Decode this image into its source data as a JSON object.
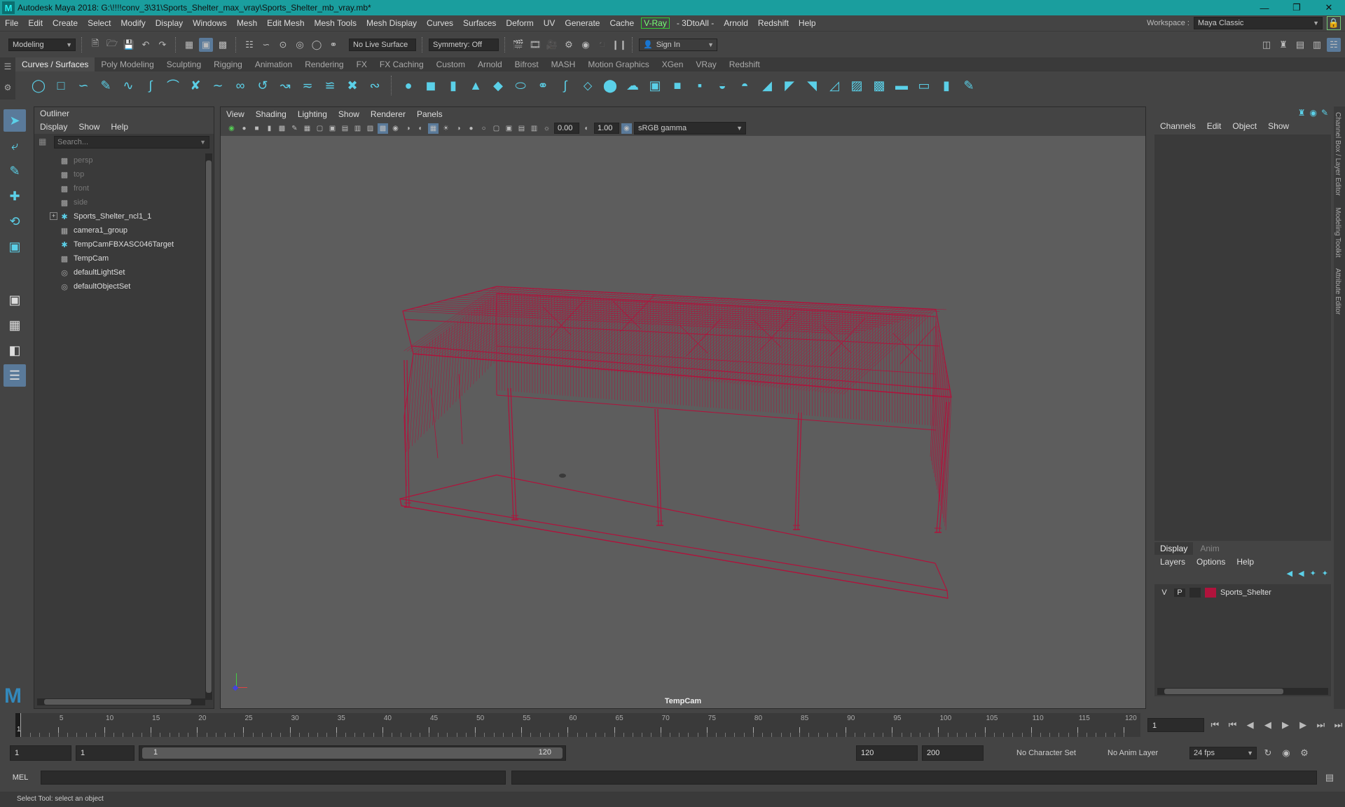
{
  "title": "Autodesk Maya 2018: G:\\!!!!conv_3\\31\\Sports_Shelter_max_vray\\Sports_Shelter_mb_vray.mb*",
  "menu": [
    "File",
    "Edit",
    "Create",
    "Select",
    "Modify",
    "Display",
    "Windows",
    "Mesh",
    "Edit Mesh",
    "Mesh Tools",
    "Mesh Display",
    "Curves",
    "Surfaces",
    "Deform",
    "UV",
    "Generate",
    "Cache",
    "V-Ray",
    "- 3DtoAll -",
    "Arnold",
    "Redshift",
    "Help"
  ],
  "workspace": {
    "label": "Workspace :",
    "value": "Maya Classic"
  },
  "status": {
    "mode": "Modeling",
    "live_surface": "No Live Surface",
    "symmetry": "Symmetry: Off",
    "sign_in": "Sign In"
  },
  "shelf_tabs": [
    "Curves / Surfaces",
    "Poly Modeling",
    "Sculpting",
    "Rigging",
    "Animation",
    "Rendering",
    "FX",
    "FX Caching",
    "Custom",
    "Arnold",
    "Bifrost",
    "MASH",
    "Motion Graphics",
    "XGen",
    "VRay",
    "Redshift"
  ],
  "outliner": {
    "title": "Outliner",
    "menu": [
      "Display",
      "Show",
      "Help"
    ],
    "search_placeholder": "Search...",
    "items": [
      {
        "label": "persp",
        "icon": "camera-icon",
        "dim": true
      },
      {
        "label": "top",
        "icon": "camera-icon",
        "dim": true
      },
      {
        "label": "front",
        "icon": "camera-icon",
        "dim": true
      },
      {
        "label": "side",
        "icon": "camera-icon",
        "dim": true
      },
      {
        "label": "Sports_Shelter_ncl1_1",
        "icon": "transform-icon",
        "dim": false,
        "expand": "+"
      },
      {
        "label": "camera1_group",
        "icon": "group-icon",
        "dim": false
      },
      {
        "label": "TempCamFBXASC046Target",
        "icon": "transform-icon",
        "dim": false
      },
      {
        "label": "TempCam",
        "icon": "camera-icon",
        "dim": false
      },
      {
        "label": "defaultLightSet",
        "icon": "set-icon",
        "dim": false
      },
      {
        "label": "defaultObjectSet",
        "icon": "set-icon",
        "dim": false
      }
    ]
  },
  "viewport": {
    "menu": [
      "View",
      "Shading",
      "Lighting",
      "Show",
      "Renderer",
      "Panels"
    ],
    "exposure": "0.00",
    "gamma": "1.00",
    "colorspace": "sRGB gamma",
    "camera": "TempCam",
    "wire_color": "#b0133c"
  },
  "channelbox": {
    "menu": [
      "Channels",
      "Edit",
      "Object",
      "Show"
    ]
  },
  "layers": {
    "tabs": [
      "Display",
      "Anim"
    ],
    "menu": [
      "Layers",
      "Options",
      "Help"
    ],
    "row": {
      "v": "V",
      "p": "P",
      "name": "Sports_Shelter",
      "color": "#b0133c"
    }
  },
  "side_tabs": [
    "Channel Box / Layer Editor",
    "Modeling Toolkit",
    "Attribute Editor"
  ],
  "timeline": {
    "ticks": [
      "5",
      "10",
      "15",
      "20",
      "25",
      "30",
      "35",
      "40",
      "45",
      "50",
      "55",
      "60",
      "65",
      "70",
      "75",
      "80",
      "85",
      "90",
      "95",
      "100",
      "105",
      "110",
      "115",
      "120"
    ],
    "start_label": "1",
    "current": "1"
  },
  "range": {
    "start": "1",
    "playback_start": "1",
    "slider_start": "1",
    "slider_end": "120",
    "playback_end": "120",
    "end": "200",
    "character_set": "No Character Set",
    "anim_layer": "No Anim Layer",
    "fps": "24 fps"
  },
  "cmd": {
    "lang": "MEL"
  },
  "help": "Select Tool: select an object"
}
